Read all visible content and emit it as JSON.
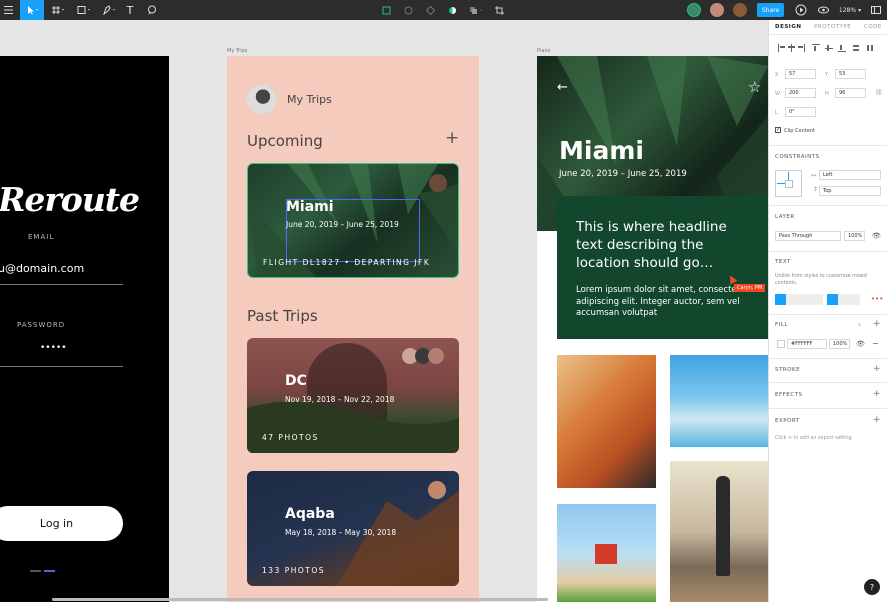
{
  "toolbar": {
    "share_label": "Share",
    "zoom": "128%",
    "collaborators": [
      "collaborator-1",
      "collaborator-2",
      "collaborator-3"
    ]
  },
  "frames": {
    "login_label": "",
    "trips_label": "My Trips",
    "plans_label": "Plans"
  },
  "login": {
    "logo": "Reroute",
    "email_label": "EMAIL",
    "email_value": "u@domain.com",
    "password_label": "PASSWORD",
    "password_value": "•••••",
    "login_button": "Log in"
  },
  "trips": {
    "header_title": "My Trips",
    "upcoming_heading": "Upcoming",
    "past_heading": "Past Trips",
    "upcoming_card": {
      "title": "Miami",
      "dates": "June 20, 2019 – June 25, 2019",
      "flight": "FLIGHT DL1827 • DEPARTING JFK"
    },
    "past_cards": [
      {
        "title": "DC",
        "dates": "Nov 19, 2018 – Nov 22, 2018",
        "sub": "47 PHOTOS"
      },
      {
        "title": "Aqaba",
        "dates": "May 18, 2018 – May 30, 2018",
        "sub": "133 PHOTOS"
      }
    ]
  },
  "plans": {
    "title": "Miami",
    "dates": "June 20, 2019 – June 25, 2019",
    "headline": "This is where headline text describing the location should go…",
    "body": "Lorem ipsum dolor sit amet, consectetur adipiscing elit. Integer auctor, sem vel accumsan volutpat",
    "cursor_tag": "Caryn, PM"
  },
  "panel": {
    "tabs": [
      "DESIGN",
      "PROTOTYPE",
      "CODE"
    ],
    "x_label": "X",
    "x_value": "57",
    "y_label": "Y",
    "y_value": "53",
    "w_label": "W",
    "w_value": "200",
    "h_label": "H",
    "h_value": "96",
    "r_label": "L",
    "r_value": "0°",
    "clip_content": "Clip Content",
    "constraints_heading": "CONSTRAINTS",
    "constraint_h": "Left",
    "constraint_v": "Top",
    "layer_heading": "LAYER",
    "blend_mode": "Pass Through",
    "opacity": "100%",
    "text_heading": "TEXT",
    "text_note": "Unlink from styles to customize mixed contents.",
    "fill_heading": "FILL",
    "fill_hex": "#FFFFFF",
    "fill_opacity": "100%",
    "stroke_heading": "STROKE",
    "effects_heading": "EFFECTS",
    "export_heading": "EXPORT",
    "export_note": "Click + to add an export setting",
    "help": "?"
  },
  "colors": {
    "toolbar": "#2c2c2c",
    "accent": "#18a0fb",
    "trips_bg": "#f4cbbd",
    "plans_green": "#12472e",
    "cursor": "#f24822"
  }
}
